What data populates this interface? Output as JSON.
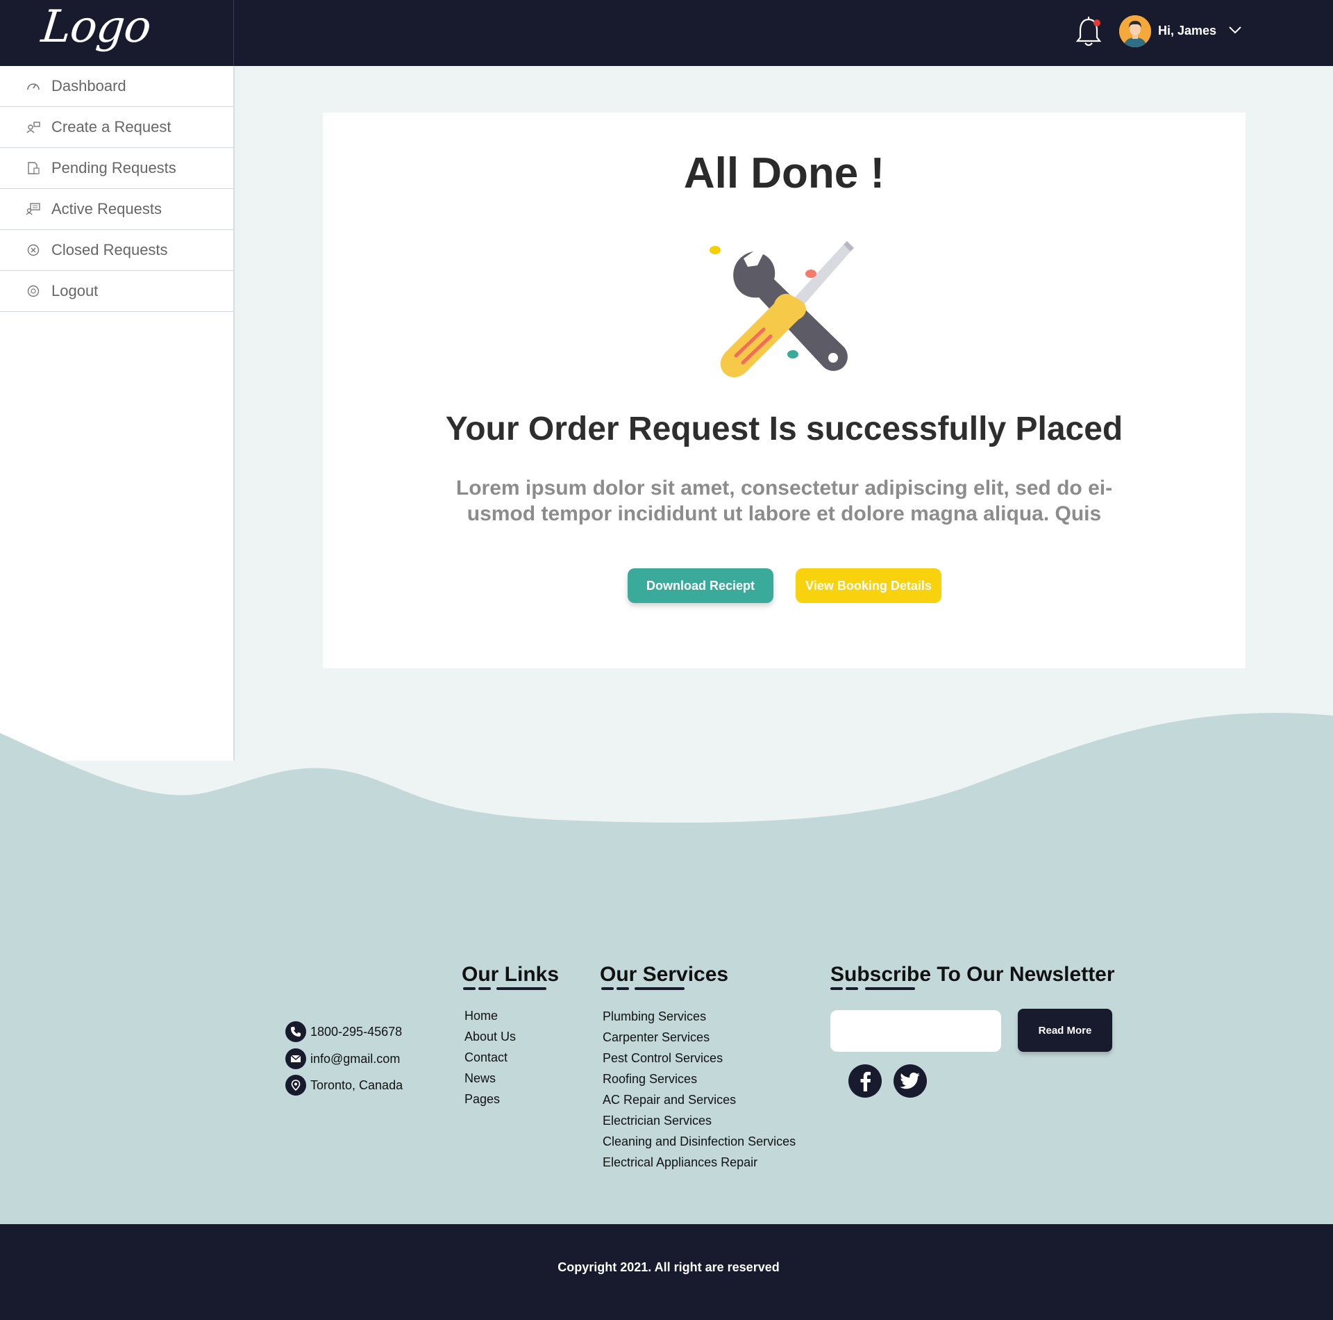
{
  "header": {
    "logo": "Logo",
    "greeting": "Hi, James"
  },
  "sidebar": {
    "items": [
      {
        "label": "Dashboard",
        "icon": "speedometer-icon"
      },
      {
        "label": "Create a Request",
        "icon": "create-request-icon"
      },
      {
        "label": "Pending Requests",
        "icon": "pending-document-icon"
      },
      {
        "label": "Active Requests",
        "icon": "active-requests-icon"
      },
      {
        "label": "Closed Requests",
        "icon": "close-circle-icon"
      },
      {
        "label": "Logout",
        "icon": "logout-icon"
      }
    ]
  },
  "main": {
    "title": "All Done !",
    "heading": "Your Order Request Is successfully Placed",
    "description": "Lorem ipsum dolor sit amet, consectetur adipiscing elit, sed do ei-usmod tempor incididunt ut labore et dolore magna aliqua. Quis",
    "download_label": "Download Reciept",
    "view_label": "View Booking Details"
  },
  "footer": {
    "contact": {
      "phone": "1800-295-45678",
      "email": "info@gmail.com",
      "location": "Toronto, Canada"
    },
    "links_heading": "Our Links",
    "links": [
      "Home",
      "About Us",
      "Contact",
      "News",
      "Pages"
    ],
    "services_heading": "Our Services",
    "services": [
      "Plumbing Services",
      "Carpenter Services",
      "Pest Control Services",
      "Roofing Services",
      "AC Repair and Services",
      "Electrician Services",
      "Cleaning and Disinfection Services",
      "Electrical Appliances Repair"
    ],
    "newsletter_heading": "Subscribe To Our Newsletter",
    "newsletter_placeholder": "",
    "read_more": "Read More",
    "copyright": "Copyright 2021. All right are reserved"
  },
  "colors": {
    "navy": "#181a2e",
    "teal": "#3aab9a",
    "yellow": "#f8d20c",
    "wave": "#c3d9d9",
    "background": "#eef4f4"
  }
}
